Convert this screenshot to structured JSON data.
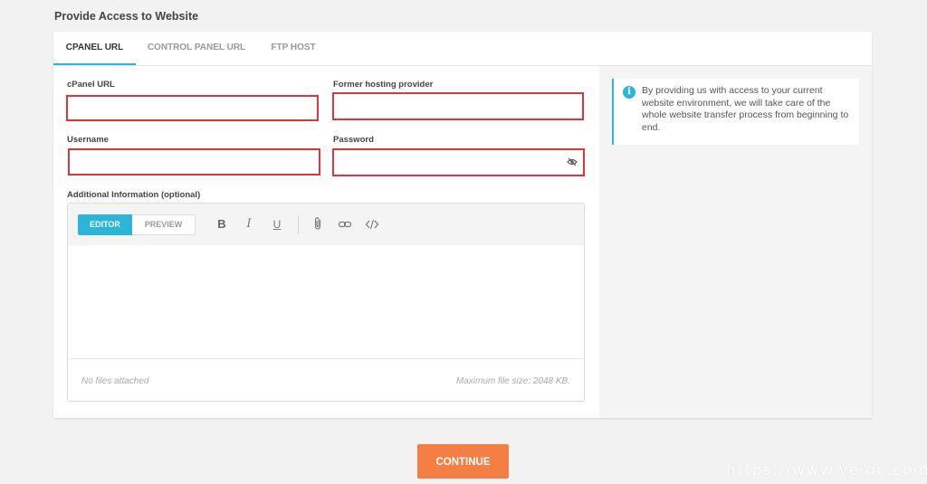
{
  "section_title": "Provide Access to Website",
  "tabs": [
    {
      "label": "CPANEL URL",
      "active": true
    },
    {
      "label": "CONTROL PANEL URL",
      "active": false
    },
    {
      "label": "FTP HOST",
      "active": false
    }
  ],
  "form": {
    "cpanel_url": {
      "label": "cPanel URL",
      "value": ""
    },
    "former_host": {
      "label": "Former hosting provider",
      "value": ""
    },
    "username": {
      "label": "Username",
      "value": ""
    },
    "password": {
      "label": "Password",
      "value": ""
    },
    "additional_info": {
      "label": "Additional Information (optional)"
    }
  },
  "editor": {
    "mode_editor": "EDITOR",
    "mode_preview": "PREVIEW",
    "tools": {
      "bold": "B",
      "italic": "I",
      "underline": "U"
    },
    "attachments_status": "No files attached",
    "max_file_size": "Maximum file size: 2048 KB."
  },
  "info": {
    "text": "By providing us with access to your current website environment, we will take care of the whole website transfer process from beginning to end."
  },
  "continue_label": "CONTINUE",
  "watermark": "https://www.veidc.com",
  "colors": {
    "accent": "#2bb5d8",
    "error_border": "#d9373b",
    "primary_button": "#f47e44"
  }
}
